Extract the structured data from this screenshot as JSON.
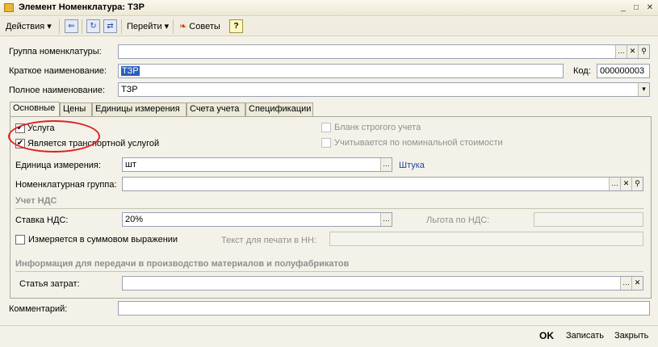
{
  "window": {
    "title": "Элемент Номенклатура: ТЗР",
    "minimize": "_",
    "maximize": "□",
    "close": "✕"
  },
  "toolbar": {
    "actions": "Действия",
    "actions_arrow": "▾",
    "goto": "Перейти",
    "goto_arrow": "▾",
    "tips": "Советы",
    "help": "?"
  },
  "header": {
    "group_label": "Группа номенклатуры:",
    "group_value": "",
    "short_label": "Краткое наименование:",
    "short_value": "ТЗР",
    "code_label": "Код:",
    "code_value": "000000003",
    "full_label": "Полное наименование:",
    "full_value": "ТЗР"
  },
  "tabs": [
    "Основные",
    "Цены",
    "Единицы измерения",
    "Счета учета",
    "Спецификации"
  ],
  "main": {
    "service_label": "Услуга",
    "service_checked": true,
    "transport_label": "Является транспортной услугой",
    "transport_checked": true,
    "strict_label": "Бланк строгого учета",
    "nominal_label": "Учитывается по номинальной стоимости",
    "unit_label": "Единица измерения:",
    "unit_value": "шт",
    "unit_link": "Штука",
    "nomgroup_label": "Номенклатурная группа:",
    "nomgroup_value": "",
    "vat_section": "Учет НДС",
    "vat_rate_label": "Ставка НДС:",
    "vat_rate_value": "20%",
    "vat_benefit_label": "Льгота по НДС:",
    "vat_benefit_value": "",
    "sum_label": "Измеряется в суммовом выражении",
    "print_label": "Текст для печати в НН:",
    "print_value": "",
    "prod_section": "Информация для передачи в производство материалов и полуфабрикатов",
    "cost_label": "Статья затрат:",
    "cost_value": ""
  },
  "footer": {
    "comment_label": "Комментарий:",
    "comment_value": "",
    "ok": "OK",
    "save": "Записать",
    "close": "Закрыть"
  }
}
